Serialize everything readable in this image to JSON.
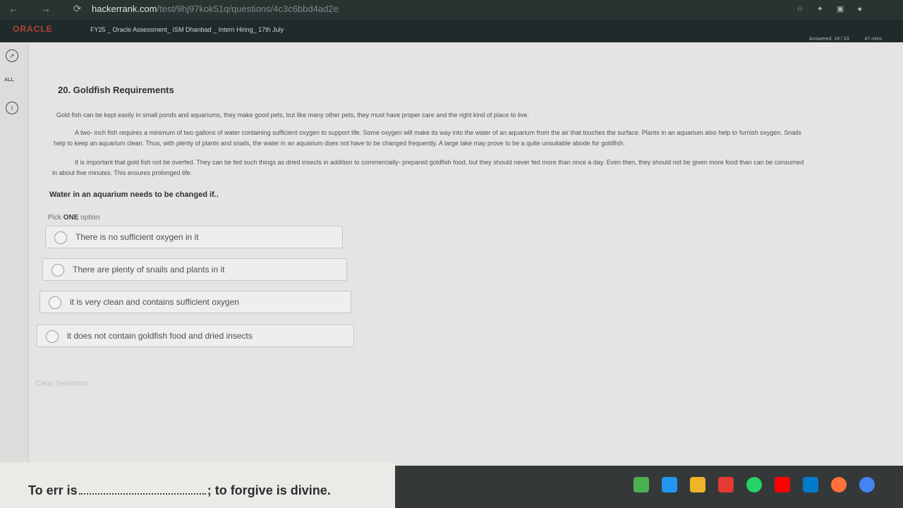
{
  "browser": {
    "url_host": "hackerrank.com",
    "url_path": "/test/9hj97kok51q/questions/4c3c6bbd4ad2e"
  },
  "header": {
    "brand": "ORACLE",
    "test_title": "FY25 _ Oracle Assessment_ ISM Dhanbad _ Intern Hiring_ 17th July",
    "meta": [
      "Answered: 18 / 33",
      "47 mins"
    ]
  },
  "sidebar": {
    "all_label": "ALL"
  },
  "question": {
    "title": "20. Goldfish Requirements",
    "paragraphs": [
      "Gold fish can be kept easily in small ponds and aquariums, they make good pets, but like many other pets, they must have proper care and the right kind of place to live.",
      "A two- inch fish requires a minimum of two gallons of water containing sufficient oxygen to support life. Some oxygen will make its way into the water of an aquarium from the air that touches the surface. Plants in an aquarium also help to furnish oxygen. Snails",
      "help to keep an aquarium clean. Thus, with plenty of plants and snails, the water in an aquarium does not have to be changed frequently. A large lake may prove to be a quite unsuitable abode for goldfish.",
      "It is important that gold fish not be overfed. They can be fed such things as dried insects in addition to commercially- prepared goldfish food, but they should never fed more than once a day. Even then, they should not be given more food than can be consumed",
      "in about five minutes. This ensures prolonged life."
    ],
    "prompt": "Water in an aquarium needs to be changed if..",
    "pick_prefix": "Pick",
    "pick_bold": "ONE",
    "pick_suffix": "option",
    "options": [
      "There is no sufficient oxygen in it",
      "There are plenty of snails and plants in it",
      "it is very clean and contains sufficient oxygen",
      "it does not contain goldfish food and dried insects"
    ],
    "clear_label": "Clear Selection"
  },
  "foreground_paper": {
    "text_left": "To err is",
    "text_right": "; to forgive is divine."
  },
  "colors": {
    "brand": "#b6433a",
    "page_bg": "#e6e4e2"
  }
}
